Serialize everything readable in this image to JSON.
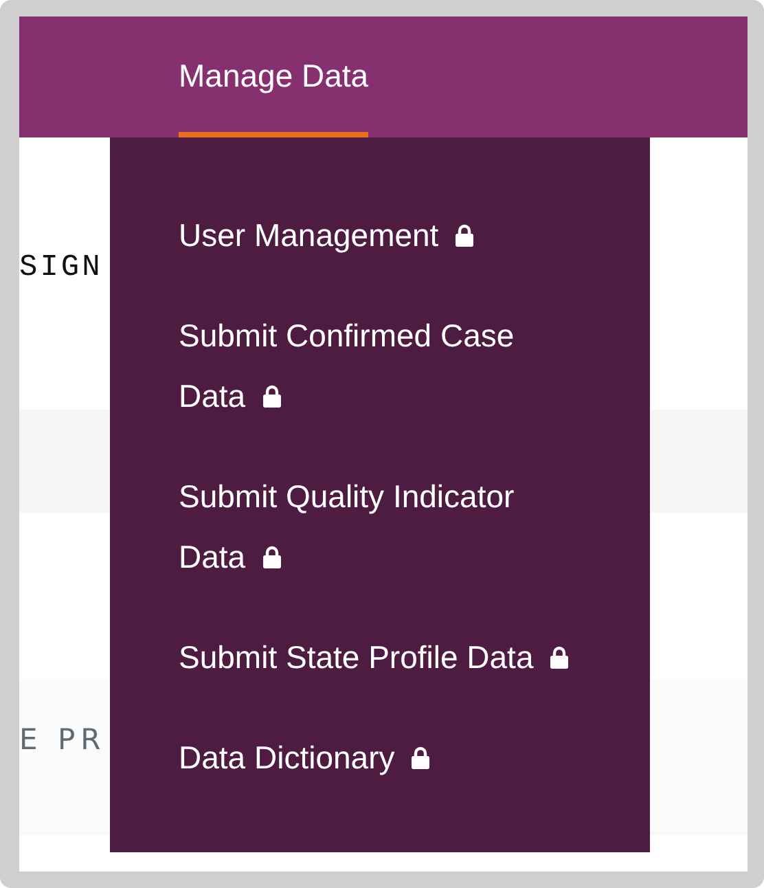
{
  "nav": {
    "items": [
      {
        "label": "Manage Data",
        "selected": true
      }
    ]
  },
  "background": {
    "heading_fragment": "SIGN",
    "card_fragment": "E PR"
  },
  "dropdown": {
    "items": [
      {
        "label": "User Management",
        "locked": true
      },
      {
        "label": "Submit Confirmed Case Data",
        "locked": true
      },
      {
        "label": "Submit Quality Indicator Data",
        "locked": true
      },
      {
        "label": "Submit State Profile Data",
        "locked": true
      },
      {
        "label": "Data Dictionary",
        "locked": true
      }
    ]
  }
}
